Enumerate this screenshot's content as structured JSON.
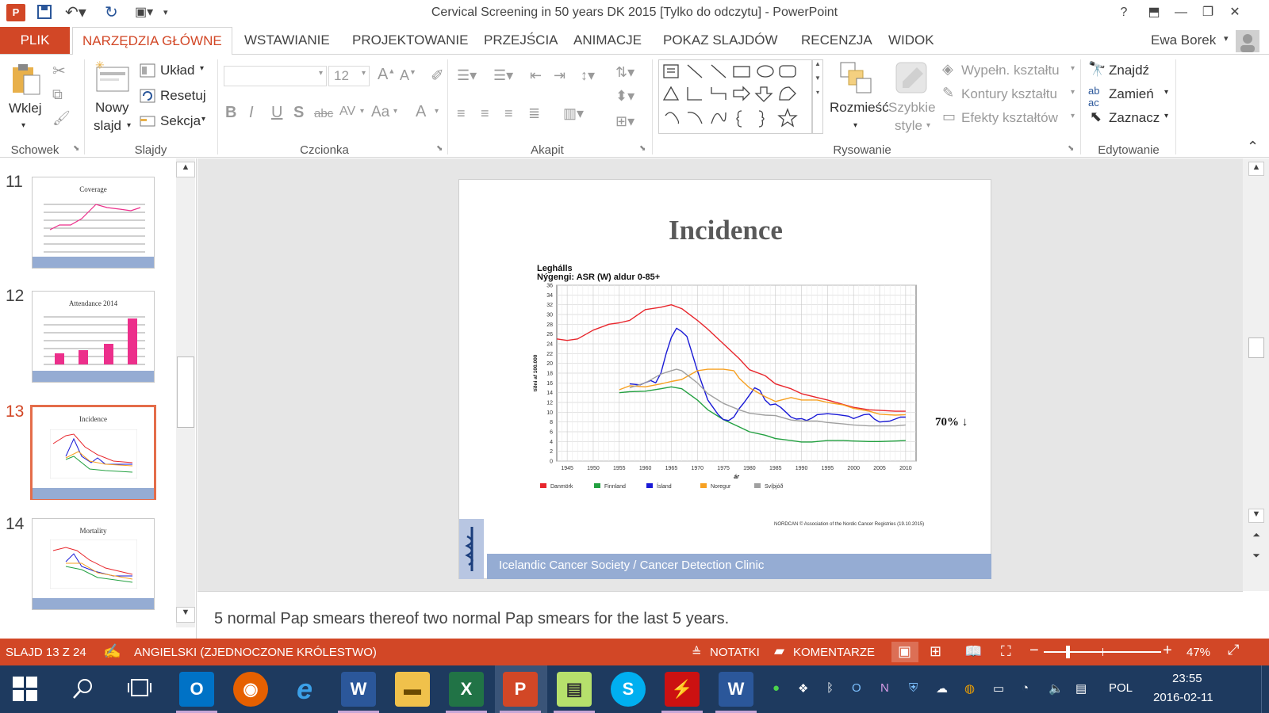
{
  "window": {
    "title": "Cervical Screening in 50 years DK 2015 [Tylko do odczytu] - PowerPoint",
    "help": "?",
    "user": "Ewa Borek"
  },
  "tabs": [
    {
      "label": "PLIK"
    },
    {
      "label": "NARZĘDZIA GŁÓWNE"
    },
    {
      "label": "WSTAWIANIE"
    },
    {
      "label": "PROJEKTOWANIE"
    },
    {
      "label": "PRZEJŚCIA"
    },
    {
      "label": "ANIMACJE"
    },
    {
      "label": "POKAZ SLAJDÓW"
    },
    {
      "label": "RECENZJA"
    },
    {
      "label": "WIDOK"
    }
  ],
  "ribbon": {
    "clipboard": {
      "group": "Schowek",
      "paste": "Wklej"
    },
    "slides": {
      "group": "Slajdy",
      "new1": "Nowy",
      "new2": "slajd",
      "layout": "Układ",
      "reset": "Resetuj",
      "section": "Sekcja"
    },
    "font": {
      "group": "Czcionka",
      "size": "12",
      "bold": "B",
      "italic": "I",
      "underline": "U",
      "shadow": "S",
      "strike": "abc",
      "spacing": "AV",
      "case": "Aa",
      "color": "A"
    },
    "paragraph": {
      "group": "Akapit"
    },
    "drawing": {
      "group": "Rysowanie",
      "arrange": "Rozmieść",
      "quick1": "Szybkie",
      "quick2": "style",
      "fill": "Wypełn. kształtu",
      "outline": "Kontury kształtu",
      "effects": "Efekty kształtów"
    },
    "editing": {
      "group": "Edytowanie",
      "find": "Znajdź",
      "replace": "Zamień",
      "select": "Zaznacz"
    }
  },
  "thumbnails": [
    {
      "num": "11",
      "title": "Coverage"
    },
    {
      "num": "12",
      "title": "Attendance 2014"
    },
    {
      "num": "13",
      "title": "Incidence"
    },
    {
      "num": "14",
      "title": "Mortality"
    }
  ],
  "slide": {
    "title": "Incidence",
    "footer": "Icelandic Cancer Society / Cancer Detection Clinic",
    "annotation": "70% ↓",
    "source": "NORDCAN © Association of the Nordic Cancer Registries (19.10.2015)"
  },
  "chart_data": {
    "type": "line",
    "title": "Leghálls",
    "subtitle": "Nýgengi: ASR (W) aldur 0-85+",
    "xlabel": "ár",
    "ylabel": "tíðni af 100.000",
    "xlim": [
      1943,
      2012
    ],
    "ylim": [
      0,
      36
    ],
    "grid": true,
    "x_ticks": [
      "1945",
      "1950",
      "1955",
      "1960",
      "1965",
      "1970",
      "1975",
      "1980",
      "1985",
      "1990",
      "1995",
      "2000",
      "2005",
      "2010"
    ],
    "y_ticks": [
      "0",
      "2",
      "4",
      "6",
      "8",
      "10",
      "12",
      "14",
      "16",
      "18",
      "20",
      "22",
      "24",
      "26",
      "28",
      "30",
      "32",
      "34",
      "36"
    ],
    "series": [
      {
        "name": "Danmörk",
        "color": "#e8262c",
        "x": [
          1943,
          1945,
          1947,
          1950,
          1953,
          1955,
          1957,
          1960,
          1963,
          1965,
          1967,
          1970,
          1972,
          1975,
          1978,
          1980,
          1983,
          1985,
          1988,
          1990,
          1993,
          1995,
          1998,
          2000,
          2003,
          2005,
          2008,
          2010
        ],
        "y": [
          25,
          24.7,
          25,
          26.8,
          28,
          28.3,
          28.8,
          31,
          31.5,
          32,
          31.2,
          28.8,
          27,
          24,
          21,
          18.7,
          17.5,
          15.8,
          14.8,
          13.8,
          13,
          12.5,
          11.6,
          11,
          10.5,
          10.4,
          10.2,
          10.2
        ]
      },
      {
        "name": "Finnland",
        "color": "#22a040",
        "x": [
          1955,
          1957,
          1960,
          1963,
          1965,
          1967,
          1970,
          1972,
          1975,
          1978,
          1980,
          1983,
          1985,
          1988,
          1990,
          1992,
          1995,
          1998,
          2000,
          2003,
          2005,
          2008,
          2010
        ],
        "y": [
          14,
          14.2,
          14.3,
          14.8,
          15.2,
          14.8,
          12.5,
          10.5,
          8.5,
          7,
          6,
          5.3,
          4.6,
          4.2,
          3.9,
          3.9,
          4.2,
          4.2,
          4.1,
          4,
          4,
          4.1,
          4.2
        ]
      },
      {
        "name": "Ísland",
        "color": "#1a1ad6",
        "x": [
          1957,
          1959,
          1961,
          1962,
          1963,
          1964,
          1965,
          1966,
          1967,
          1968,
          1969,
          1970,
          1971,
          1972,
          1973,
          1974,
          1975,
          1976,
          1977,
          1978,
          1979,
          1980,
          1981,
          1982,
          1983,
          1984,
          1985,
          1986,
          1987,
          1988,
          1989,
          1990,
          1991,
          1992,
          1993,
          1995,
          1997,
          1999,
          2000,
          2002,
          2003,
          2004,
          2005,
          2007,
          2009,
          2010
        ],
        "y": [
          15.8,
          15.6,
          16.5,
          16,
          18,
          22,
          25.3,
          27.2,
          26.5,
          25.5,
          22,
          18.5,
          15.5,
          12.5,
          11,
          9.5,
          8.5,
          8.3,
          9,
          10.7,
          12,
          13.5,
          15,
          14.5,
          12.5,
          11.5,
          11.7,
          11,
          10,
          9,
          8.6,
          8.7,
          8.3,
          8.8,
          9.5,
          9.7,
          9.5,
          9.2,
          8.7,
          9.5,
          9.6,
          8.6,
          8,
          8.2,
          9,
          9
        ]
      },
      {
        "name": "Noregur",
        "color": "#f7a122",
        "x": [
          1955,
          1957,
          1960,
          1963,
          1965,
          1967,
          1970,
          1972,
          1975,
          1977,
          1978,
          1980,
          1983,
          1985,
          1988,
          1990,
          1993,
          1995,
          1998,
          2000,
          2003,
          2005,
          2008,
          2010
        ],
        "y": [
          14.6,
          15.4,
          15.2,
          15.8,
          16.3,
          16.7,
          18.5,
          18.8,
          18.8,
          18.5,
          17,
          15,
          13.2,
          12.2,
          13,
          12.5,
          12.5,
          12,
          11.5,
          10.8,
          10.2,
          9.6,
          9.4,
          9.5
        ]
      },
      {
        "name": "Svíþjóð",
        "color": "#a0a0a0",
        "x": [
          1957,
          1960,
          1963,
          1965,
          1966,
          1967,
          1970,
          1972,
          1975,
          1978,
          1980,
          1983,
          1985,
          1988,
          1990,
          1993,
          1995,
          1998,
          2000,
          2003,
          2005,
          2008,
          2010
        ],
        "y": [
          15,
          16,
          17.8,
          18.5,
          18.8,
          18.5,
          16,
          13.8,
          11.8,
          10.5,
          9.8,
          9.4,
          9.3,
          8.4,
          8.2,
          8.2,
          7.9,
          7.6,
          7.4,
          7.2,
          7.2,
          7.2,
          7.4
        ]
      }
    ]
  },
  "notes": {
    "text": "5 normal Pap smears thereof two normal Pap smears for the last 5 years."
  },
  "status": {
    "slide": "SLAJD 13 Z 24",
    "language": "ANGIELSKI (ZJEDNOCZONE KRÓLESTWO)",
    "notes": "NOTATKI",
    "comments": "KOMENTARZE",
    "zoom": "47%"
  },
  "tray": {
    "lang": "POL",
    "time": "23:55",
    "date": "2016-02-11"
  },
  "colors": {
    "accent": "#d24726",
    "footer": "#95acd3"
  },
  "icons": [
    "search-icon",
    "task-view-icon",
    "outlook-icon",
    "firefox-icon",
    "ie-icon",
    "word-icon",
    "explorer-icon",
    "excel-icon",
    "powerpoint-icon",
    "notes-icon",
    "skype-icon",
    "acrobat-icon"
  ]
}
